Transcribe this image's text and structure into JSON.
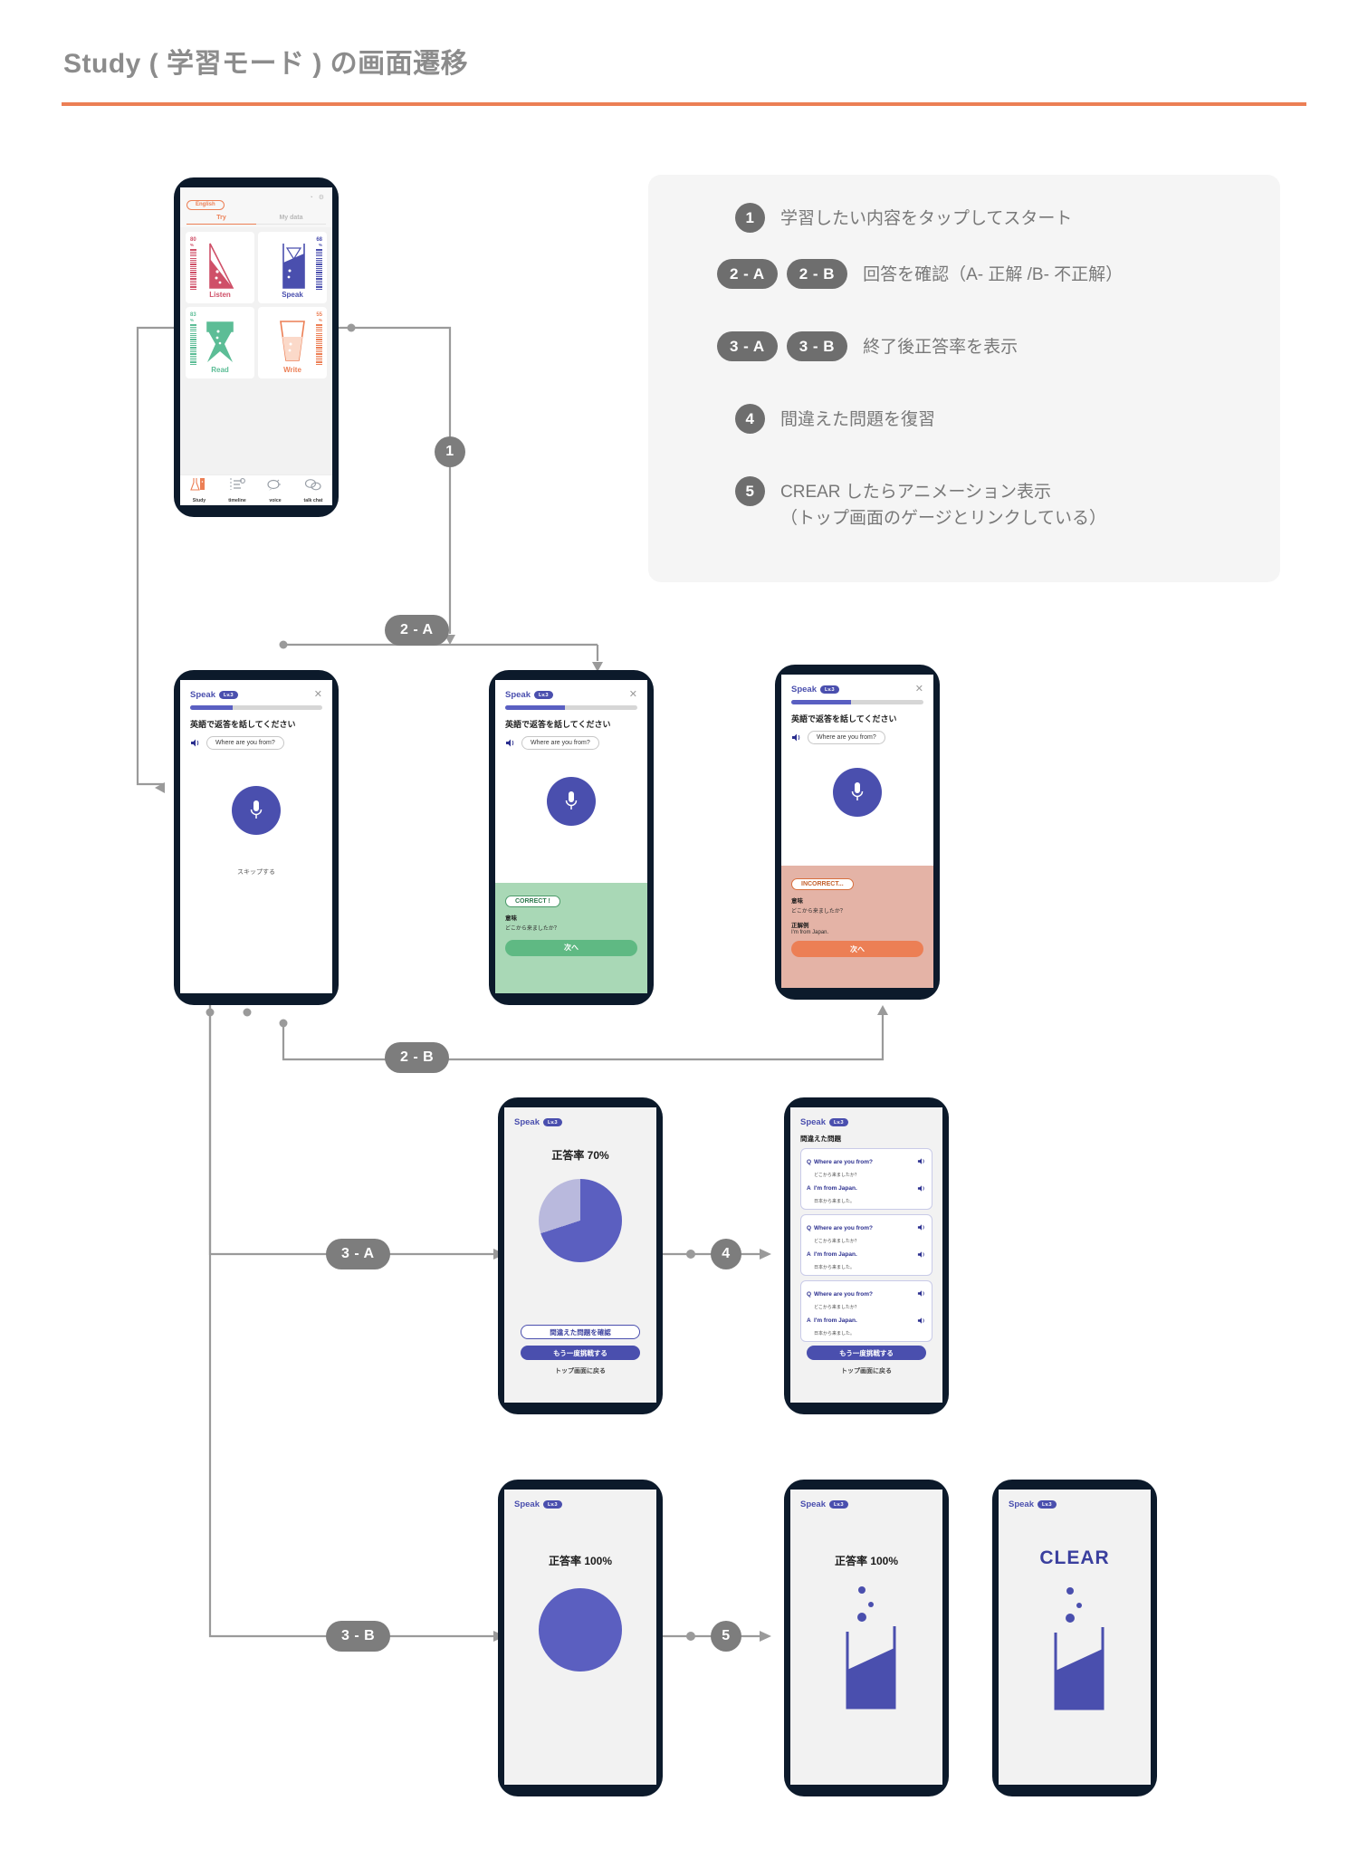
{
  "header": {
    "title": "Study ( 学習モード ) の画面遷移",
    "rule_color": "#ec7f55"
  },
  "legend": {
    "items": [
      {
        "badges": [
          "1"
        ],
        "text": "学習したい内容をタップしてスタート"
      },
      {
        "badges": [
          "2 - A",
          "2 - B"
        ],
        "text": "回答を確認（A- 正解 /B- 不正解）"
      },
      {
        "badges": [
          "3 - A",
          "3 - B"
        ],
        "text": "終了後正答率を表示"
      },
      {
        "badges": [
          "4"
        ],
        "text": "間違えた問題を復習"
      },
      {
        "badges": [
          "5"
        ],
        "text": "CREAR したらアニメーション表示\n（トップ画面のゲージとリンクしている）"
      }
    ]
  },
  "flow_markers": {
    "m1": "1",
    "m2a": "2 - A",
    "m2b": "2 - B",
    "m3a": "3 - A",
    "m3b": "3 - B",
    "m4": "4",
    "m5": "5"
  },
  "screens": {
    "home": {
      "language_chip": "English",
      "tabs": [
        {
          "label": "Try",
          "active": true
        },
        {
          "label": "My data",
          "active": false
        }
      ],
      "cards": [
        {
          "label": "Listen",
          "value": "80",
          "unit": "%",
          "color": "#cf5068"
        },
        {
          "label": "Speak",
          "value": "68",
          "unit": "%",
          "color": "#4a4fae"
        },
        {
          "label": "Read",
          "value": "83",
          "unit": "%",
          "color": "#5cbd96"
        },
        {
          "label": "Write",
          "value": "55",
          "unit": "%",
          "color": "#ec7f55"
        }
      ],
      "nav": [
        {
          "label": "Study",
          "icon": "flask-icon",
          "active": true
        },
        {
          "label": "timeline",
          "icon": "timeline-icon",
          "active": false
        },
        {
          "label": "voice",
          "icon": "voice-icon",
          "active": false
        },
        {
          "label": "talk chat",
          "icon": "chat-icon",
          "active": false
        }
      ]
    },
    "speak_question": {
      "title": "Speak",
      "level": "Lv.3",
      "close": "✕",
      "progress_percent": 32,
      "prompt": "英語で返答を話してください",
      "phrase": "Where are you from?",
      "skip_label": "スキップする",
      "mic_icon": "microphone-icon",
      "speaker_icon": "speaker-icon"
    },
    "speak_correct": {
      "title": "Speak",
      "level": "Lv.3",
      "close": "✕",
      "progress_percent": 45,
      "prompt": "英語で返答を話してください",
      "phrase": "Where are you from?",
      "status_chip": "CORRECT !",
      "meaning_label": "意味",
      "meaning_text": "どこから来ましたか？",
      "next_label": "次へ",
      "accent": "#5fb983",
      "panel_bg": "#a9d8b6"
    },
    "speak_incorrect": {
      "title": "Speak",
      "level": "Lv.3",
      "close": "✕",
      "progress_percent": 45,
      "prompt": "英語で返答を話してください",
      "phrase": "Where are you from?",
      "status_chip": "INCORRECT...",
      "meaning_label": "意味",
      "meaning_text": "どこから来ましたか？",
      "answer_label": "正解例",
      "answer_text": "I'm  from Japan.",
      "next_label": "次へ",
      "accent": "#ec7f55",
      "panel_bg": "#e4b3a6"
    },
    "score_70": {
      "title": "Speak",
      "level": "Lv.3",
      "score_label": "正答率 70%",
      "review_button": "間違えた問題を確認",
      "retry_button": "もう一度挑戦する",
      "back_link": "トップ画面に戻る",
      "donut_percent": 70,
      "donut_color": "#5b5fc0",
      "donut_track": "#b9b9dd"
    },
    "review": {
      "title": "Speak",
      "level": "Lv.3",
      "heading": "間違えた問題",
      "items": [
        {
          "q_key": "Q",
          "q_en": "Where are you from?",
          "q_ja": "どこから来ましたか？",
          "a_key": "A",
          "a_en": "I'm from Japan.",
          "a_ja": "日本から来ました。"
        },
        {
          "q_key": "Q",
          "q_en": "Where are you from?",
          "q_ja": "どこから来ましたか？",
          "a_key": "A",
          "a_en": "I'm from Japan.",
          "a_ja": "日本から来ました。"
        },
        {
          "q_key": "Q",
          "q_en": "Where are you from?",
          "q_ja": "どこから来ましたか？",
          "a_key": "A",
          "a_en": "I'm from Japan.",
          "a_ja": "日本から来ました。"
        }
      ],
      "retry_button": "もう一度挑戦する",
      "back_link": "トップ画面に戻る",
      "speaker_icon": "speaker-icon"
    },
    "score_100": {
      "title": "Speak",
      "level": "Lv.3",
      "score_label": "正答率 100%",
      "donut_percent": 100,
      "donut_color": "#5b5fc0"
    },
    "animation_100": {
      "title": "Speak",
      "level": "Lv.3",
      "score_label": "正答率 100%",
      "beaker_icon": "beaker-icon"
    },
    "clear": {
      "title": "Speak",
      "level": "Lv.3",
      "clear_label": "CLEAR",
      "beaker_icon": "beaker-icon"
    }
  },
  "colors": {
    "brand_purple": "#4a4fae",
    "orange": "#ec7f55",
    "green": "#5fb983",
    "marker_gray": "#7d7d7d",
    "wire_gray": "#9a9a9a"
  }
}
